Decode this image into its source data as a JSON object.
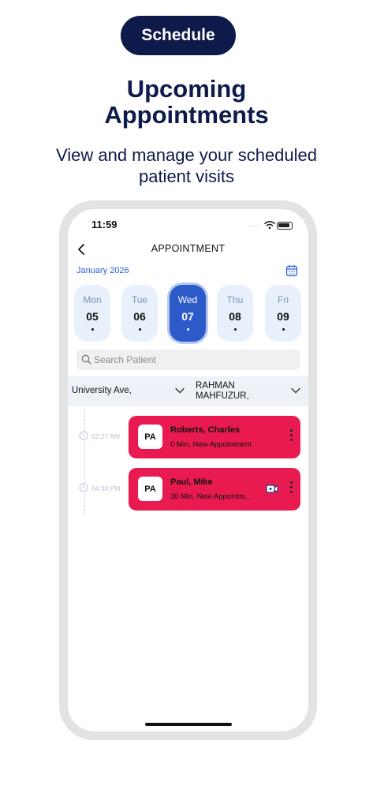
{
  "promo": {
    "pill": "Schedule",
    "headline_line1": "Upcoming",
    "headline_line2": "Appointments",
    "subline_line1": "View and manage your scheduled",
    "subline_line2": "patient visits"
  },
  "status_bar": {
    "time": "11:59",
    "signal": "....",
    "icons": [
      "wifi-icon",
      "battery-icon"
    ]
  },
  "header": {
    "title": "APPOINTMENT",
    "back_icon": "chevron-left-icon",
    "calendar_icon": "calendar-icon"
  },
  "calendar": {
    "month": "January 2026",
    "days": [
      {
        "name": "Mon",
        "number": "05",
        "selected": false
      },
      {
        "name": "Tue",
        "number": "06",
        "selected": false
      },
      {
        "name": "Wed",
        "number": "07",
        "selected": true
      },
      {
        "name": "Thu",
        "number": "08",
        "selected": false
      },
      {
        "name": "Fri",
        "number": "09",
        "selected": false
      }
    ]
  },
  "search": {
    "placeholder": "Search Patient",
    "value": ""
  },
  "filters": {
    "location": "University Ave,",
    "provider_line1": "RAHMAN",
    "provider_line2": "MAHFUZUR,"
  },
  "appointments": [
    {
      "time": "02:27 AM",
      "initials": "PA",
      "name": "Roberts, Charles",
      "description": "0 Min, New Appointment",
      "video": false
    },
    {
      "time": "04:30 PM",
      "initials": "PA",
      "name": "Paul, Mike",
      "description": "30 Min, New Appointm...",
      "video": true
    }
  ],
  "colors": {
    "navy": "#0e1a4a",
    "accent_blue": "#2d5ac9",
    "card_red": "#e81a4f",
    "day_bg": "#e8f0fb"
  }
}
